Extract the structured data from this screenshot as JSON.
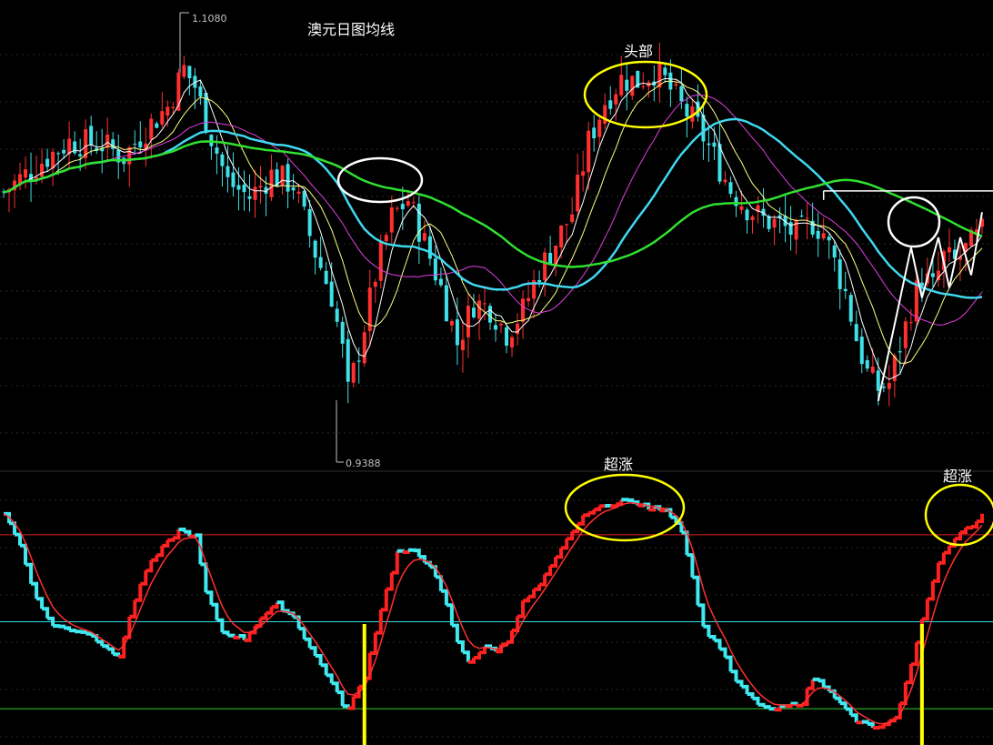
{
  "title": "澳元日图均线",
  "colors": {
    "background": "#000000",
    "candle_up": "#ff3030",
    "candle_down": "#40e0e8",
    "ma_white": "#ffffff",
    "ma_yellow": "#ffff80",
    "ma_magenta": "#e040e0",
    "ma_cyan": "#40d8f0",
    "ma_green": "#30e030",
    "circle_white": "#ffffff",
    "circle_yellow": "#ffff00",
    "osc_up": "#ff2020",
    "osc_down": "#40e8f0",
    "osc_signal": "#ff3030",
    "line_upper": "#e02020",
    "line_mid": "#30e0e8",
    "line_lower": "#30d030",
    "marker_bar": "#ffff00"
  },
  "annotations": {
    "head": "头部",
    "overbought_1": "超涨",
    "overbought_2": "超涨"
  },
  "chart_data": [
    {
      "type": "candlestick",
      "title": "澳元日图均线",
      "high_label": "1.1080",
      "low_label": "0.9388",
      "ylim": [
        0.93,
        1.11
      ],
      "n_bars": 180,
      "price_path": [
        [
          0,
          1.038
        ],
        [
          4,
          1.045
        ],
        [
          8,
          1.052
        ],
        [
          12,
          1.058
        ],
        [
          18,
          1.057
        ],
        [
          22,
          1.052
        ],
        [
          26,
          1.063
        ],
        [
          30,
          1.072
        ],
        [
          33,
          1.087
        ],
        [
          35,
          1.08
        ],
        [
          38,
          1.06
        ],
        [
          41,
          1.042
        ],
        [
          45,
          1.036
        ],
        [
          49,
          1.045
        ],
        [
          53,
          1.041
        ],
        [
          57,
          1.014
        ],
        [
          60,
          0.997
        ],
        [
          62,
          0.975
        ],
        [
          63,
          0.958
        ],
        [
          65,
          0.975
        ],
        [
          68,
          1.005
        ],
        [
          71,
          1.028
        ],
        [
          74,
          1.035
        ],
        [
          77,
          1.018
        ],
        [
          80,
          1.0
        ],
        [
          83,
          0.978
        ],
        [
          86,
          0.994
        ],
        [
          89,
          0.992
        ],
        [
          92,
          0.982
        ],
        [
          95,
          0.991
        ],
        [
          98,
          1.007
        ],
        [
          101,
          1.018
        ],
        [
          104,
          1.03
        ],
        [
          107,
          1.058
        ],
        [
          110,
          1.074
        ],
        [
          113,
          1.083
        ],
        [
          116,
          1.082
        ],
        [
          119,
          1.086
        ],
        [
          121,
          1.082
        ],
        [
          124,
          1.072
        ],
        [
          127,
          1.064
        ],
        [
          130,
          1.052
        ],
        [
          133,
          1.039
        ],
        [
          136,
          1.032
        ],
        [
          139,
          1.027
        ],
        [
          142,
          1.025
        ],
        [
          145,
          1.021
        ],
        [
          148,
          1.026
        ],
        [
          150,
          1.022
        ],
        [
          152,
          1.01
        ],
        [
          154,
          0.998
        ],
        [
          156,
          0.98
        ],
        [
          158,
          0.966
        ],
        [
          160,
          0.96
        ],
        [
          162,
          0.962
        ],
        [
          164,
          0.977
        ],
        [
          166,
          0.992
        ],
        [
          168,
          1.005
        ],
        [
          170,
          1.0
        ],
        [
          172,
          1.012
        ],
        [
          174,
          1.01
        ],
        [
          176,
          1.015
        ],
        [
          179,
          1.022
        ]
      ],
      "moving_averages": [
        {
          "color": "ma_white",
          "period": 5
        },
        {
          "color": "ma_yellow",
          "period": 10
        },
        {
          "color": "ma_magenta",
          "period": 20
        },
        {
          "color": "ma_cyan",
          "period": 30
        },
        {
          "color": "ma_green",
          "period": 60
        }
      ],
      "resistance_line": {
        "value": 1.0385,
        "from_bar": 150,
        "color": "ma_white"
      },
      "zigzag": [
        [
          160,
          0.955
        ],
        [
          166,
          1.016
        ],
        [
          168,
          0.996
        ],
        [
          171,
          1.02
        ],
        [
          173,
          1.0
        ],
        [
          175,
          1.02
        ],
        [
          177,
          1.005
        ],
        [
          179,
          1.03
        ]
      ]
    },
    {
      "type": "oscillator",
      "ylim": [
        -5,
        110
      ],
      "levels": [
        {
          "value": 90,
          "color": "line_upper"
        },
        {
          "value": 50,
          "color": "line_mid"
        },
        {
          "value": 10,
          "color": "line_lower"
        }
      ],
      "path": [
        [
          0,
          100
        ],
        [
          3,
          85
        ],
        [
          6,
          60
        ],
        [
          9,
          48
        ],
        [
          11,
          47
        ],
        [
          15,
          45
        ],
        [
          19,
          38
        ],
        [
          21,
          33
        ],
        [
          23,
          53
        ],
        [
          26,
          74
        ],
        [
          29,
          84
        ],
        [
          32,
          92
        ],
        [
          35,
          89
        ],
        [
          37,
          63
        ],
        [
          40,
          45
        ],
        [
          44,
          42
        ],
        [
          47,
          52
        ],
        [
          50,
          58
        ],
        [
          53,
          52
        ],
        [
          56,
          38
        ],
        [
          59,
          26
        ],
        [
          62,
          12
        ],
        [
          63,
          10
        ],
        [
          66,
          25
        ],
        [
          69,
          56
        ],
        [
          72,
          82
        ],
        [
          75,
          82
        ],
        [
          78,
          76
        ],
        [
          81,
          57
        ],
        [
          83,
          40
        ],
        [
          85,
          32
        ],
        [
          88,
          38
        ],
        [
          90,
          37
        ],
        [
          92,
          41
        ],
        [
          95,
          59
        ],
        [
          98,
          67
        ],
        [
          101,
          79
        ],
        [
          104,
          92
        ],
        [
          107,
          101
        ],
        [
          110,
          103
        ],
        [
          113,
          106
        ],
        [
          116,
          104
        ],
        [
          118,
          102
        ],
        [
          121,
          102
        ],
        [
          124,
          92
        ],
        [
          126,
          70
        ],
        [
          128,
          47
        ],
        [
          131,
          38
        ],
        [
          134,
          22
        ],
        [
          137,
          14
        ],
        [
          140,
          9
        ],
        [
          143,
          11
        ],
        [
          146,
          13
        ],
        [
          148,
          24
        ],
        [
          151,
          19
        ],
        [
          153,
          12
        ],
        [
          156,
          4
        ],
        [
          160,
          1
        ],
        [
          163,
          5
        ],
        [
          166,
          30
        ],
        [
          168,
          52
        ],
        [
          171,
          77
        ],
        [
          173,
          85
        ],
        [
          175,
          92
        ],
        [
          178,
          96
        ],
        [
          179,
          99
        ]
      ],
      "markers": [
        66,
        168
      ]
    }
  ]
}
